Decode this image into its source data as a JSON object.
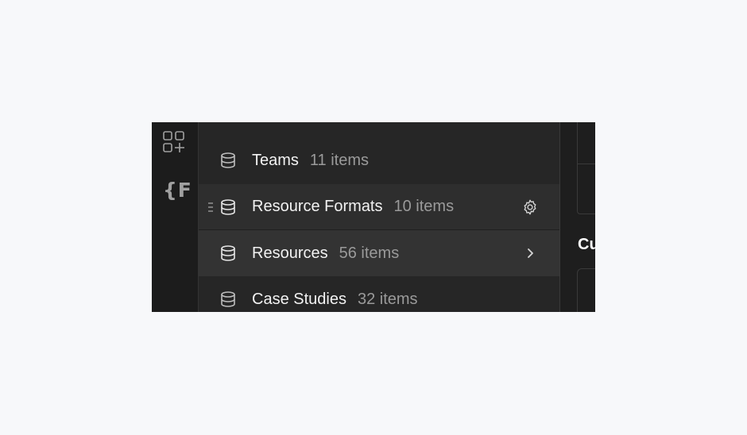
{
  "rail": {
    "items": [
      {
        "icon": "add-apps-icon"
      },
      {
        "icon": "variables-icon",
        "glyph": "{F"
      }
    ]
  },
  "collections": [
    {
      "name": "",
      "count": "",
      "state": "partial"
    },
    {
      "name": "Teams",
      "count": "11 items",
      "state": "normal"
    },
    {
      "name": "Resource Formats",
      "count": "10 items",
      "state": "hover",
      "trailing_icon": "gear-icon"
    },
    {
      "name": "Resources",
      "count": "56 items",
      "state": "selected",
      "trailing_icon": "chevron-right-icon"
    },
    {
      "name": "Case Studies",
      "count": "32 items",
      "state": "normal"
    }
  ],
  "settings_panel": {
    "heading": "Cu"
  },
  "colors": {
    "panel_bg": "#1e1e1e",
    "list_bg": "#262626",
    "hover_bg": "#2e2e2e",
    "selected_bg": "#333333",
    "text": "#f2f2f2",
    "muted_text": "#9a9a9a"
  }
}
